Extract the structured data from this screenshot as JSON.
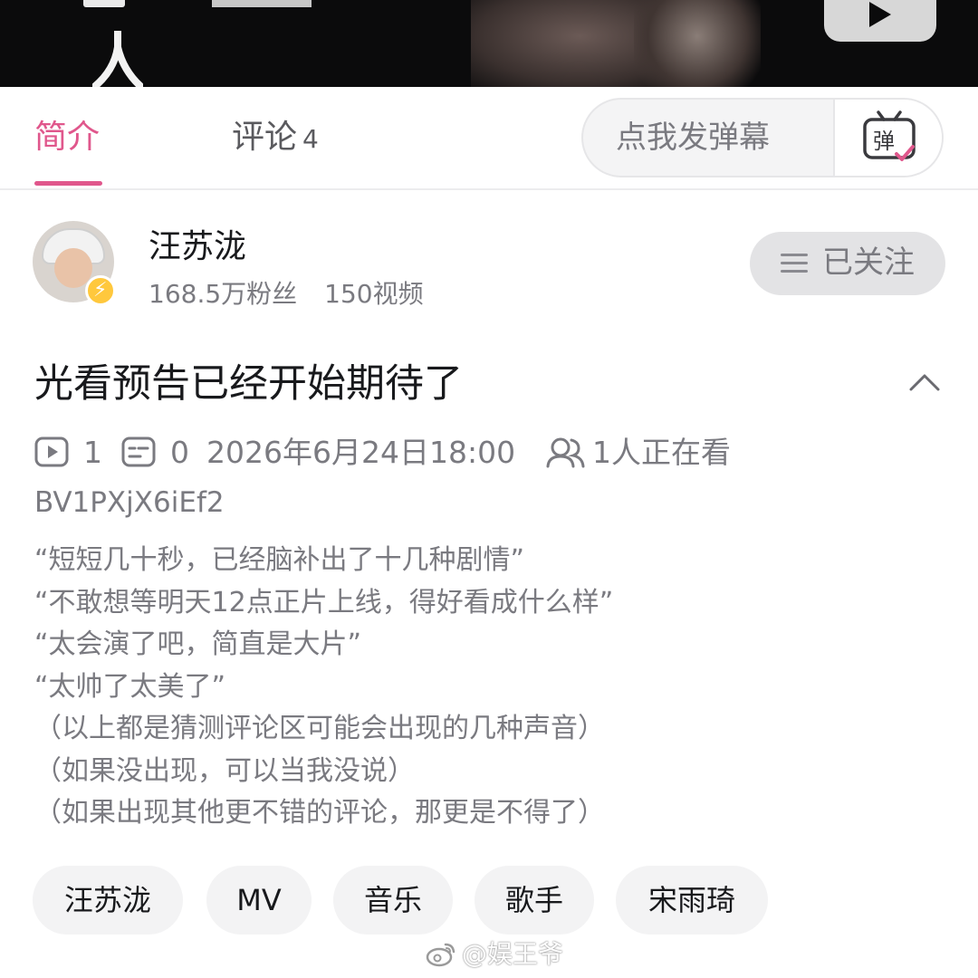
{
  "tabs": {
    "intro_label": "简介",
    "comments_label": "评论",
    "comments_count": "4",
    "danmaku_placeholder": "点我发弹幕",
    "danmaku_icon_text": "弹"
  },
  "uploader": {
    "name": "汪苏泷",
    "followers": "168.5万粉丝",
    "videos": "150视频",
    "follow_label": "已关注"
  },
  "video": {
    "title": "光看预告已经开始期待了",
    "plays": "1",
    "danmaku_count": "0",
    "datetime": "2026年6月24日18:00",
    "watching": "1人正在看",
    "bvid": "BV1PXjX6iEf2"
  },
  "description": [
    "“短短几十秒，已经脑补出了十几种剧情”",
    "“不敢想等明天12点正片上线，得好看成什么样”",
    "“太会演了吧，简直是大片”",
    "“太帅了太美了”",
    "（以上都是猜测评论区可能会出现的几种声音）",
    "（如果没出现，可以当我没说）",
    "（如果出现其他更不错的评论，那更是不得了）"
  ],
  "tags": [
    "汪苏泷",
    "MV",
    "音乐",
    "歌手",
    "宋雨琦"
  ],
  "watermark": "@娱王爷",
  "colors": {
    "accent_pink": "#e0578c",
    "text_primary": "#18191c",
    "text_secondary": "#7a7a80",
    "pill_bg": "#f3f3f4"
  },
  "icons": {
    "play_count": "play-icon",
    "danmaku_count": "danmaku-list-icon",
    "watching": "people-icon",
    "collapse": "chevron-up-icon",
    "verified": "lightning-badge-icon",
    "follow_menu": "menu-icon",
    "danmaku_button": "tv-danmaku-icon"
  }
}
